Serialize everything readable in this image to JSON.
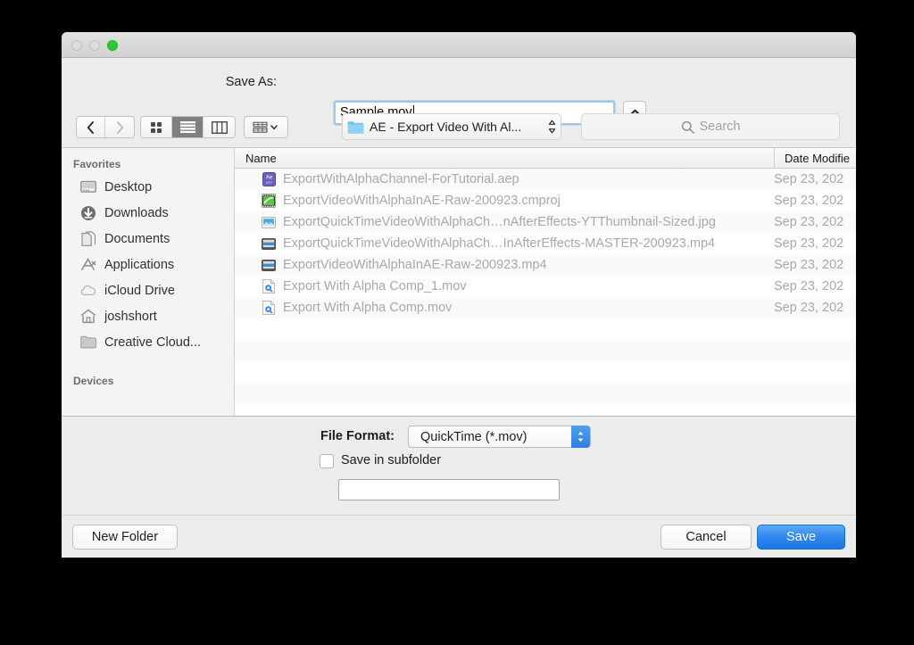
{
  "window": {
    "traffic_lights": [
      "close",
      "minimize",
      "zoom"
    ],
    "zoom_color": "#2bcb34"
  },
  "saveas": {
    "label": "Save As:",
    "value": "Sample.mov",
    "placeholder": "",
    "disclosure_icon": "chevron-up-icon"
  },
  "toolbar": {
    "back_icon": "chevron-left-icon",
    "forward_icon": "chevron-right-icon",
    "view_icon_grid": "icon-view-icon",
    "view_icon_list": "list-view-icon",
    "view_icon_column": "column-view-icon",
    "action_icon": "action-menu-icon",
    "selected_view": "list",
    "path_label": "AE - Export Video With Al...",
    "path_icon": "folder-icon",
    "path_arrows_icon": "updown-chevron-icon",
    "search_placeholder": "Search",
    "search_icon": "search-icon",
    "search_value": ""
  },
  "sidebar": {
    "sections": [
      {
        "header": "Favorites",
        "items": [
          {
            "label": "Desktop",
            "icon": "desktop-icon"
          },
          {
            "label": "Downloads",
            "icon": "downloads-icon"
          },
          {
            "label": "Documents",
            "icon": "documents-icon"
          },
          {
            "label": "Applications",
            "icon": "applications-icon"
          },
          {
            "label": "iCloud Drive",
            "icon": "icloud-icon"
          },
          {
            "label": "joshshort",
            "icon": "home-icon"
          },
          {
            "label": "Creative Cloud...",
            "icon": "folder-icon"
          }
        ]
      },
      {
        "header": "Devices",
        "items": []
      }
    ]
  },
  "filelist": {
    "columns": [
      "Name",
      "Date Modifie"
    ],
    "rows": [
      {
        "name": "ExportWithAlphaChannel-ForTutorial.aep",
        "date": "Sep 23, 202",
        "icon": "ae-project-icon"
      },
      {
        "name": "ExportVideoWithAlphaInAE-Raw-200923.cmproj",
        "date": "Sep 23, 202",
        "icon": "camtasia-project-icon"
      },
      {
        "name": "ExportQuickTimeVideoWithAlphaCh…nAfterEffects-YTThumbnail-Sized.jpg",
        "date": "Sep 23, 202",
        "icon": "jpeg-image-icon"
      },
      {
        "name": "ExportQuickTimeVideoWithAlphaCh…InAfterEffects-MASTER-200923.mp4",
        "date": "Sep 23, 202",
        "icon": "mp4-video-icon"
      },
      {
        "name": "ExportVideoWithAlphaInAE-Raw-200923.mp4",
        "date": "Sep 23, 202",
        "icon": "mp4-video-icon"
      },
      {
        "name": "Export With Alpha Comp_1.mov",
        "date": "Sep 23, 202",
        "icon": "quicktime-movie-icon"
      },
      {
        "name": "Export With Alpha Comp.mov",
        "date": "Sep 23, 202",
        "icon": "quicktime-movie-icon"
      }
    ],
    "empty_rows": 4
  },
  "options": {
    "file_format_label": "File Format:",
    "file_format_value": "QuickTime (*.mov)",
    "file_format_options": [
      "QuickTime (*.mov)"
    ],
    "save_in_subfolder_label": "Save in subfolder",
    "save_in_subfolder_checked": false,
    "subfolder_value": "",
    "subfolder_placeholder": ""
  },
  "footer": {
    "new_folder_label": "New Folder",
    "cancel_label": "Cancel",
    "save_label": "Save",
    "save_accent_color": "#2f86ec"
  }
}
